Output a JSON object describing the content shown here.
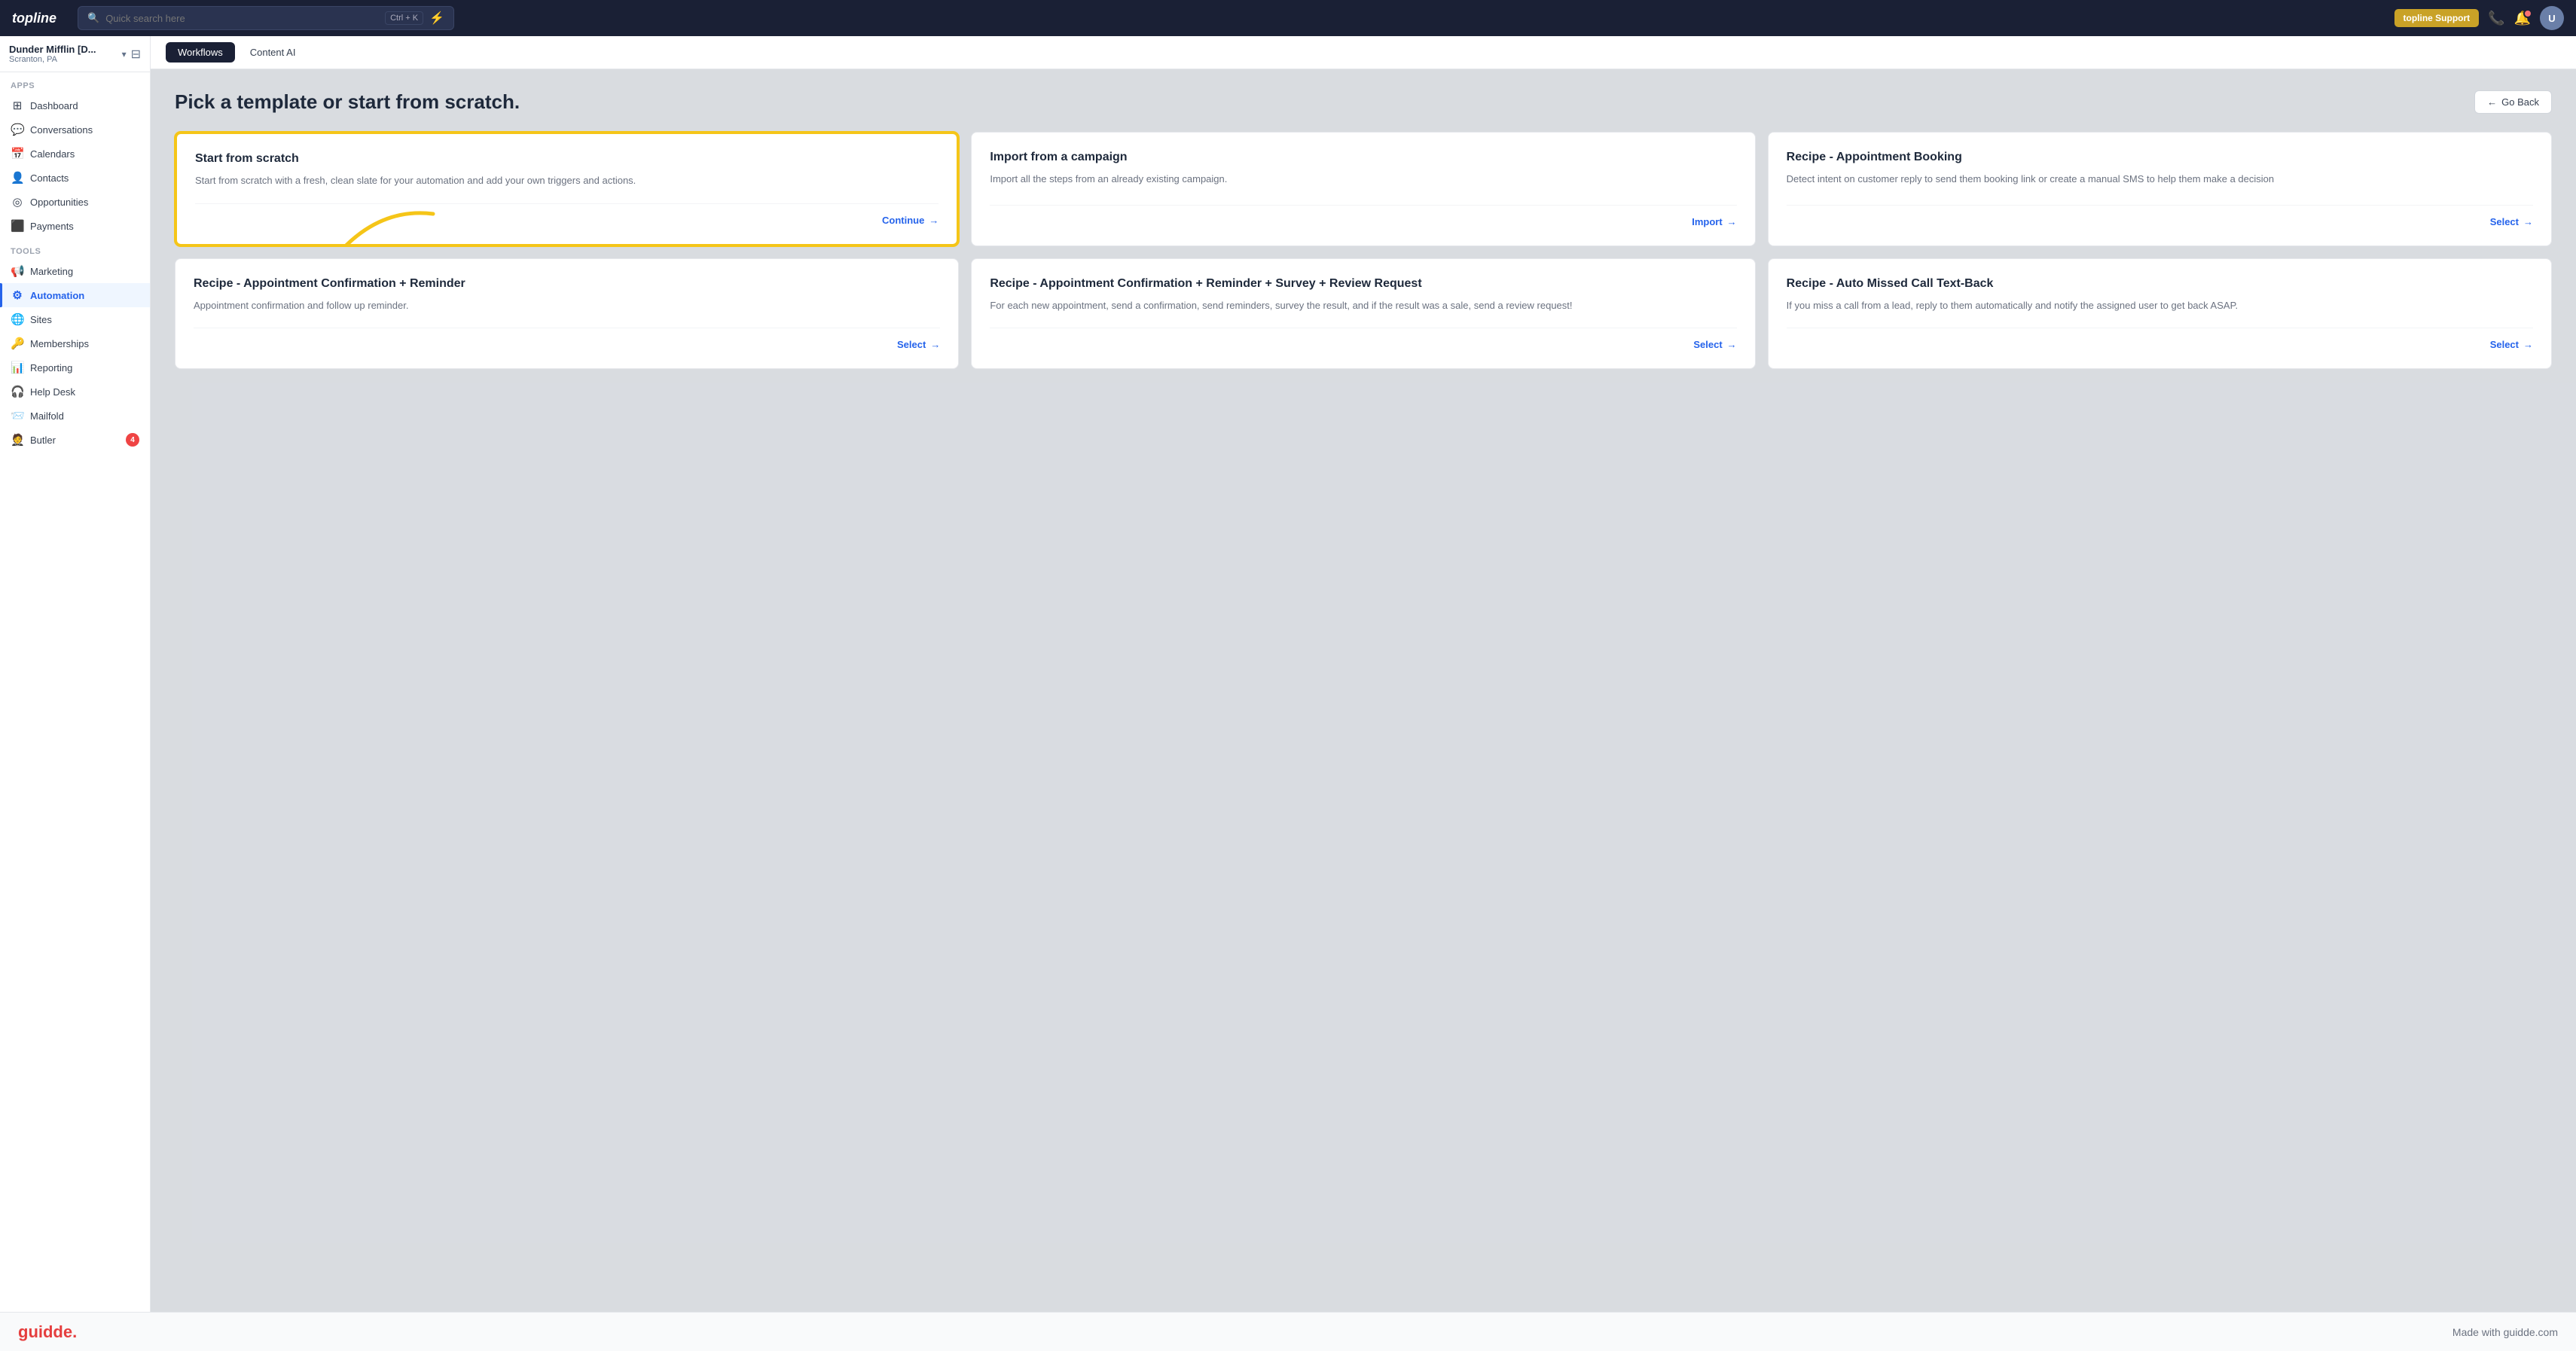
{
  "topnav": {
    "logo": "topline",
    "search_placeholder": "Quick search here",
    "search_shortcut": "Ctrl + K",
    "bolt_icon": "⚡",
    "support_label": "topline Support",
    "avatar_initials": "U"
  },
  "sidebar": {
    "workspace_name": "Dunder Mifflin [D...",
    "workspace_sub": "Scranton, PA",
    "sections": [
      {
        "label": "Apps",
        "items": [
          {
            "id": "dashboard",
            "icon": "⊞",
            "label": "Dashboard",
            "active": false
          },
          {
            "id": "conversations",
            "icon": "💬",
            "label": "Conversations",
            "active": false
          },
          {
            "id": "calendars",
            "icon": "📅",
            "label": "Calendars",
            "active": false
          },
          {
            "id": "contacts",
            "icon": "👤",
            "label": "Contacts",
            "active": false
          },
          {
            "id": "opportunities",
            "icon": "◎",
            "label": "Opportunities",
            "active": false
          },
          {
            "id": "payments",
            "icon": "⬛",
            "label": "Payments",
            "active": false
          }
        ]
      },
      {
        "label": "Tools",
        "items": [
          {
            "id": "marketing",
            "icon": "📢",
            "label": "Marketing",
            "active": false
          },
          {
            "id": "automation",
            "icon": "⚙",
            "label": "Automation",
            "active": true
          },
          {
            "id": "sites",
            "icon": "🌐",
            "label": "Sites",
            "active": false
          },
          {
            "id": "memberships",
            "icon": "🔑",
            "label": "Memberships",
            "active": false
          },
          {
            "id": "reporting",
            "icon": "📊",
            "label": "Reporting",
            "active": false
          },
          {
            "id": "helpdesk",
            "icon": "🎧",
            "label": "Help Desk",
            "active": false
          },
          {
            "id": "mailfold",
            "icon": "📨",
            "label": "Mailfold",
            "active": false
          },
          {
            "id": "butler",
            "icon": "🤵",
            "label": "Butler",
            "active": false
          }
        ]
      }
    ],
    "bottom_badge": "4"
  },
  "sub_tabs": [
    {
      "id": "workflows",
      "label": "Workflows",
      "active": true
    },
    {
      "id": "content_ai",
      "label": "Content AI",
      "active": false
    }
  ],
  "page": {
    "title": "Pick a template or start from scratch.",
    "go_back_label": "Go Back"
  },
  "templates": [
    {
      "id": "start_from_scratch",
      "title": "Start from scratch",
      "description": "Start from scratch with a fresh, clean slate for your automation and add your own triggers and actions.",
      "action_label": "Continue",
      "highlighted": true
    },
    {
      "id": "import_from_campaign",
      "title": "Import from a campaign",
      "description": "Import all the steps from an already existing campaign.",
      "action_label": "Import",
      "highlighted": false
    },
    {
      "id": "recipe_appointment_booking",
      "title": "Recipe - Appointment Booking",
      "description": "Detect intent on customer reply to send them booking link or create a manual SMS to help them make a decision",
      "action_label": "Select",
      "highlighted": false
    },
    {
      "id": "recipe_appointment_confirmation_reminder",
      "title": "Recipe - Appointment Confirmation + Reminder",
      "description": "Appointment confirmation and follow up reminder.",
      "action_label": "Select",
      "highlighted": false
    },
    {
      "id": "recipe_appointment_confirmation_survey",
      "title": "Recipe - Appointment Confirmation + Reminder + Survey + Review Request",
      "description": "For each new appointment, send a confirmation, send reminders, survey the result, and if the result was a sale, send a review request!",
      "action_label": "Select",
      "highlighted": false
    },
    {
      "id": "recipe_auto_missed_call",
      "title": "Recipe - Auto Missed Call Text-Back",
      "description": "If you miss a call from a lead, reply to them automatically and notify the assigned user to get back ASAP.",
      "action_label": "Select",
      "highlighted": false
    }
  ],
  "footer": {
    "logo": "guidde.",
    "made_with": "Made with guidde.com"
  }
}
